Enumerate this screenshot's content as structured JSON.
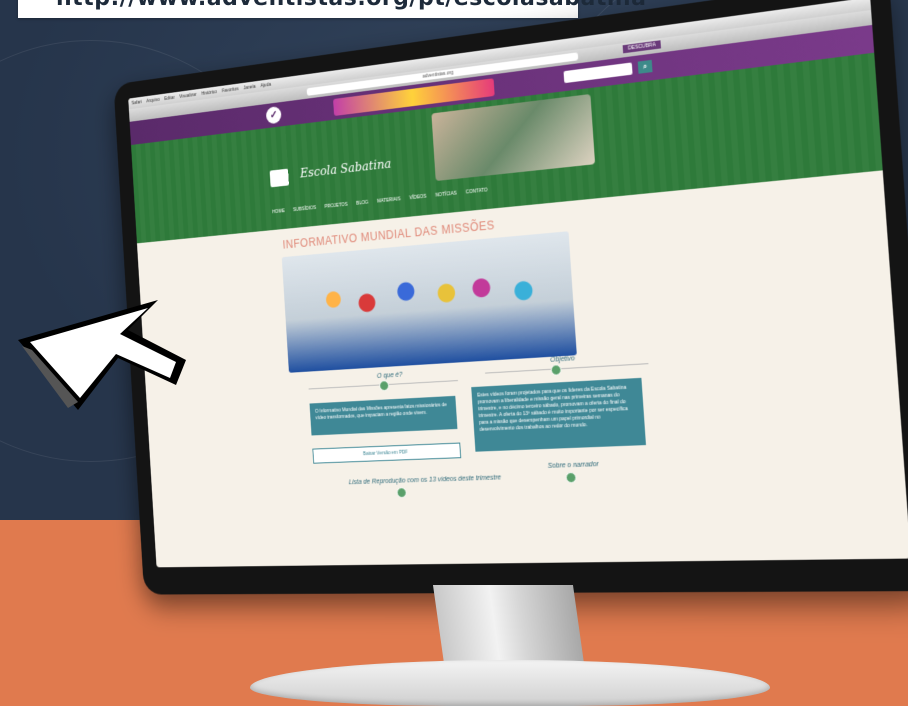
{
  "banner": {
    "url": "http://www.adventistas.org/pt/escolasabatina"
  },
  "browser": {
    "menubar": [
      "Safari",
      "Arquivo",
      "Editar",
      "Visualizar",
      "Histórico",
      "Favoritos",
      "Janela",
      "Ajuda"
    ],
    "address": "adventistas.org",
    "descubra": "DESCUBRA"
  },
  "site": {
    "name": "Escola Sabatina",
    "nav": [
      "Home",
      "Subsídios",
      "Projetos",
      "Blog",
      "Materiais",
      "Vídeos",
      "Notícias",
      "Contato"
    ]
  },
  "content": {
    "title": "INFORMATIVO MUNDIAL DAS MISSÕES",
    "what_label": "O que é?",
    "objective_label": "Objetivo",
    "what_text": "O Informativo Mundial das Missões apresenta fatos missionários de vídeo transformados, que impactam a região onde vivem.",
    "objective_text": "Estes vídeos foram projetados para que os líderes da Escola Sabatina promovam a liberalidade e missão geral nas primeiras semanas do trimestre, e no décimo terceiro sábado, promovam a oferta do final do trimestre. A oferta do 13º sábado é muito importante por ser específica para a missão que desempenham um papel primordial no desenvolvimento dos trabalhos ao redor do mundo.",
    "pdf_button": "Baixar Versão em PDF",
    "playlist_label": "Lista de Reprodução com os 13 vídeos deste trimestre",
    "narrator_label": "Sobre o narrador"
  },
  "colors": {
    "purple": "#5a2a6a",
    "green": "#2e7a3a",
    "teal": "#3f8896",
    "orange": "#e07a4e",
    "navy": "#26354b"
  }
}
